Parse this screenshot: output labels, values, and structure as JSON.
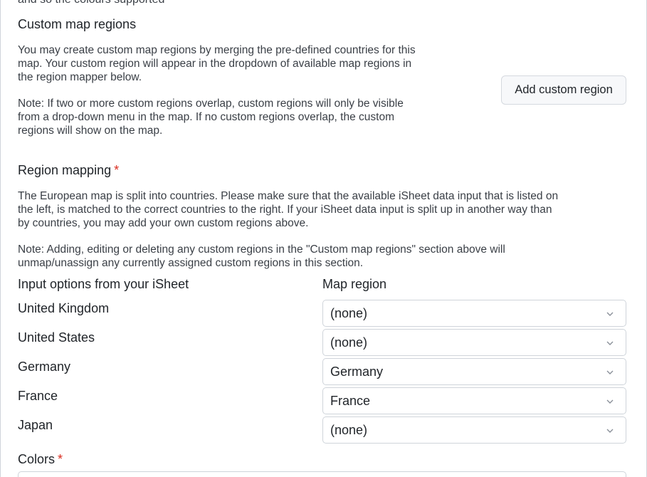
{
  "cut_top_text": "and so the colours supported",
  "custom_regions": {
    "title": "Custom map regions",
    "description_lines": [
      "You may create custom map regions by merging the pre-defined countries for this",
      "map. Your custom region will appear in the dropdown of available map regions in",
      "the region mapper below."
    ],
    "note_lines": [
      "Note: If two or more custom regions overlap, custom regions will only be visible",
      "from a drop-down menu in the map. If no custom regions overlap, the custom",
      "regions will show on the map."
    ],
    "add_button_label": "Add custom region"
  },
  "region_mapping": {
    "title": "Region mapping",
    "required_marker": "*",
    "description_lines": [
      "The European map is split into countries. Please make sure that the available iSheet data input that is listed on",
      "the left, is matched to the correct countries to the right. If your iSheet data input is split up in another way than",
      "by countries, you may add your own custom regions above."
    ],
    "note_lines": [
      "Note: Adding, editing or deleting any custom regions in the \"Custom map regions\" section above will",
      "unmap/unassign any currently assigned custom regions in this section."
    ],
    "input_header": "Input options from your iSheet",
    "region_header": "Map region",
    "rows": [
      {
        "input": "United Kingdom",
        "region": "(none)"
      },
      {
        "input": "United States",
        "region": "(none)"
      },
      {
        "input": "Germany",
        "region": "Germany"
      },
      {
        "input": "France",
        "region": "France"
      },
      {
        "input": "Japan",
        "region": "(none)"
      }
    ]
  },
  "colors": {
    "title": "Colors",
    "required_marker": "*"
  },
  "theme": {
    "required_color": "#d92d20",
    "border_color": "#cfd4da",
    "button_bg": "#f7f8fa"
  },
  "icons": {
    "dropdown": "chevron-down-icon"
  }
}
